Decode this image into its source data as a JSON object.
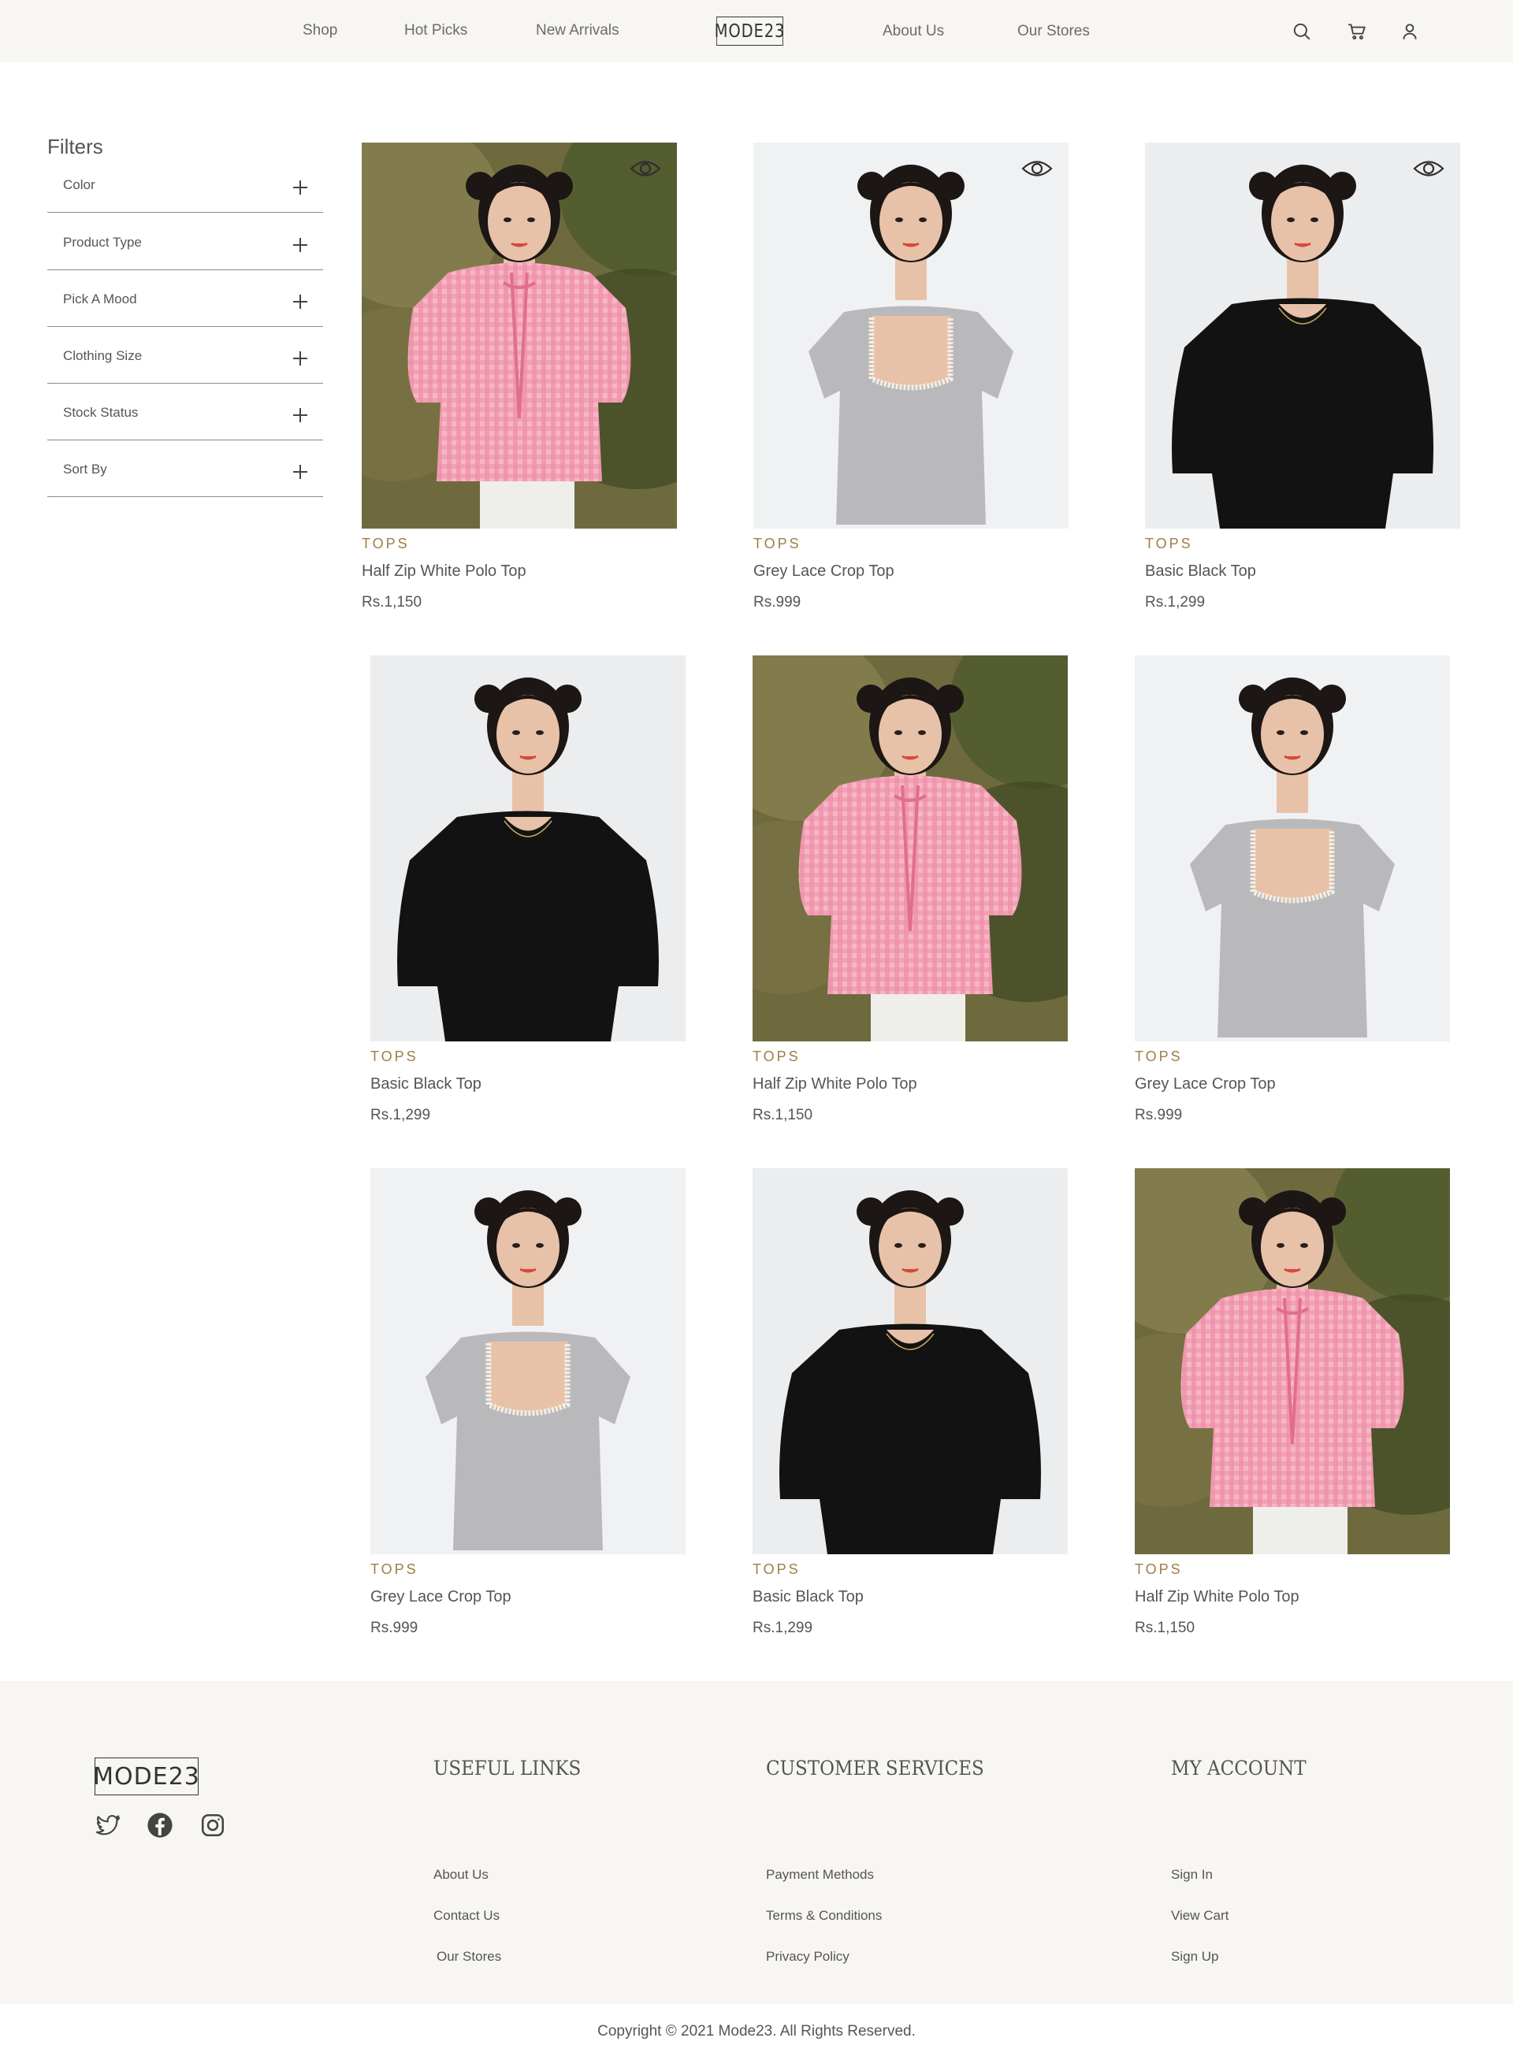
{
  "header": {
    "nav_left": [
      "Shop",
      "Hot Picks",
      "New Arrivals"
    ],
    "logo": "MODE23",
    "nav_right": [
      "About Us",
      "Our Stores"
    ],
    "icons": [
      "search-icon",
      "cart-icon",
      "user-icon"
    ]
  },
  "filters": {
    "title": "Filters",
    "items": [
      "Color",
      "Product Type",
      "Pick A Mood",
      "Clothing Size",
      "Stock Status",
      "Sort By"
    ]
  },
  "products": [
    {
      "category": "TOPS",
      "name": "Half Zip White Polo Top",
      "price": "Rs.1,150",
      "image": "pink-gingham-top",
      "quick_view": true
    },
    {
      "category": "TOPS",
      "name": "Grey Lace Crop Top",
      "price": "Rs.999",
      "image": "grey-lace-top",
      "quick_view": true
    },
    {
      "category": "TOPS",
      "name": "Basic Black Top",
      "price": "Rs.1,299",
      "image": "black-top",
      "quick_view": true
    },
    {
      "category": "TOPS",
      "name": "Basic Black Top",
      "price": "Rs.1,299",
      "image": "black-top",
      "quick_view": false
    },
    {
      "category": "TOPS",
      "name": "Half Zip White Polo Top",
      "price": "Rs.1,150",
      "image": "pink-gingham-top",
      "quick_view": false
    },
    {
      "category": "TOPS",
      "name": "Grey Lace Crop Top",
      "price": "Rs.999",
      "image": "grey-lace-top",
      "quick_view": false
    },
    {
      "category": "TOPS",
      "name": "Grey Lace Crop Top",
      "price": "Rs.999",
      "image": "grey-lace-top",
      "quick_view": false
    },
    {
      "category": "TOPS",
      "name": "Basic Black Top",
      "price": "Rs.1,299",
      "image": "black-top",
      "quick_view": false
    },
    {
      "category": "TOPS",
      "name": "Half Zip White Polo Top",
      "price": "Rs.1,150",
      "image": "pink-gingham-top",
      "quick_view": false
    }
  ],
  "footer": {
    "logo": "MODE23",
    "social": [
      "twitter-icon",
      "facebook-icon",
      "instagram-icon"
    ],
    "useful_links": {
      "title": "USEFUL LINKS",
      "links": [
        "About Us",
        "Contact Us",
        "Our Stores"
      ]
    },
    "customer_services": {
      "title": "CUSTOMER SERVICES",
      "links": [
        "Payment Methods",
        "Terms & Conditions",
        "Privacy Policy"
      ]
    },
    "my_account": {
      "title": "MY ACCOUNT",
      "links": [
        "Sign In",
        "View Cart",
        "Sign Up"
      ]
    },
    "copyright": "Copyright © 2021 Mode23. All Rights Reserved."
  },
  "colors": {
    "header_bg": "#f8f6f2",
    "footer_bg": "#f8f6f2",
    "category_text": "#a07d45",
    "body_text": "#555555"
  }
}
